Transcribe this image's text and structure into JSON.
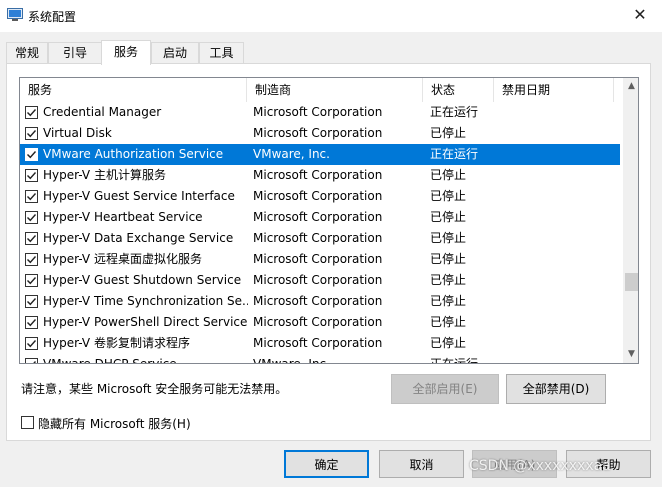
{
  "window": {
    "title": "系统配置",
    "close_glyph": "✕"
  },
  "tabs": [
    {
      "label": "常规",
      "active": false
    },
    {
      "label": "引导",
      "active": false
    },
    {
      "label": "服务",
      "active": true
    },
    {
      "label": "启动",
      "active": false
    },
    {
      "label": "工具",
      "active": false
    }
  ],
  "columns": {
    "service": "服务",
    "manufacturer": "制造商",
    "status": "状态",
    "disabled_date": "禁用日期"
  },
  "services": [
    {
      "name": "Credential Manager",
      "manufacturer": "Microsoft Corporation",
      "status": "正在运行",
      "date": "",
      "checked": true,
      "selected": false
    },
    {
      "name": "Virtual Disk",
      "manufacturer": "Microsoft Corporation",
      "status": "已停止",
      "date": "",
      "checked": true,
      "selected": false
    },
    {
      "name": "VMware Authorization Service",
      "manufacturer": "VMware, Inc.",
      "status": "正在运行",
      "date": "",
      "checked": true,
      "selected": true
    },
    {
      "name": "Hyper-V 主机计算服务",
      "manufacturer": "Microsoft Corporation",
      "status": "已停止",
      "date": "",
      "checked": true,
      "selected": false
    },
    {
      "name": "Hyper-V Guest Service Interface",
      "manufacturer": "Microsoft Corporation",
      "status": "已停止",
      "date": "",
      "checked": true,
      "selected": false
    },
    {
      "name": "Hyper-V Heartbeat Service",
      "manufacturer": "Microsoft Corporation",
      "status": "已停止",
      "date": "",
      "checked": true,
      "selected": false
    },
    {
      "name": "Hyper-V Data Exchange Service",
      "manufacturer": "Microsoft Corporation",
      "status": "已停止",
      "date": "",
      "checked": true,
      "selected": false
    },
    {
      "name": "Hyper-V 远程桌面虚拟化服务",
      "manufacturer": "Microsoft Corporation",
      "status": "已停止",
      "date": "",
      "checked": true,
      "selected": false
    },
    {
      "name": "Hyper-V Guest Shutdown Service",
      "manufacturer": "Microsoft Corporation",
      "status": "已停止",
      "date": "",
      "checked": true,
      "selected": false
    },
    {
      "name": "Hyper-V Time Synchronization Se...",
      "manufacturer": "Microsoft Corporation",
      "status": "已停止",
      "date": "",
      "checked": true,
      "selected": false
    },
    {
      "name": "Hyper-V PowerShell Direct Service",
      "manufacturer": "Microsoft Corporation",
      "status": "已停止",
      "date": "",
      "checked": true,
      "selected": false
    },
    {
      "name": "Hyper-V 卷影复制请求程序",
      "manufacturer": "Microsoft Corporation",
      "status": "已停止",
      "date": "",
      "checked": true,
      "selected": false
    },
    {
      "name": "VMware DHCP Service",
      "manufacturer": "VMware, Inc.",
      "status": "正在运行",
      "date": "",
      "checked": true,
      "selected": false
    }
  ],
  "notice": "请注意，某些 Microsoft 安全服务可能无法禁用。",
  "buttons": {
    "enable_all": "全部启用(E)",
    "disable_all": "全部禁用(D)",
    "ok": "确定",
    "cancel": "取消",
    "apply": "应用(A)",
    "help": "帮助"
  },
  "hide_ms": {
    "label": "隐藏所有 Microsoft 服务(H)",
    "checked": false
  },
  "watermark": "CSDN @xxxxxxxxaa",
  "colors": {
    "selection": "#0078d7",
    "default_button_border": "#0078d7"
  }
}
